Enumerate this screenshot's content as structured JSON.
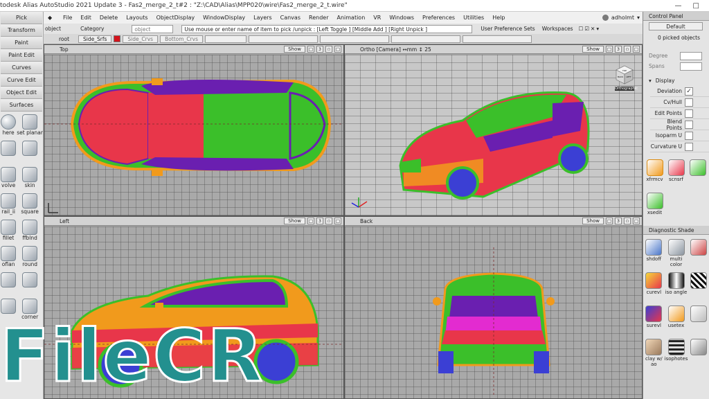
{
  "window": {
    "title": "todesk Alias AutoStudio 2021 Update 3   - Fas2_merge_2_t#2 : \"Z:\\CAD\\Alias\\MPP020\\wire\\Fas2_merge_2_t.wire\"",
    "minimize": "—",
    "maximize": "□"
  },
  "palette": {
    "buttons": [
      "Pick",
      "Transform",
      "Paint",
      "Paint Edit",
      "Curves",
      "Curve Edit",
      "Object Edit",
      "Surfaces"
    ],
    "tools": [
      {
        "label": "here",
        "icon": "sphere-icon"
      },
      {
        "label": "set planar",
        "icon": "set-planar-icon"
      },
      {
        "label": "",
        "icon": "rotate-icon"
      },
      {
        "label": "",
        "icon": "revolve-surface-icon"
      },
      {
        "label": "volve",
        "icon": "revolve-icon"
      },
      {
        "label": "skin",
        "icon": "skin-icon"
      },
      {
        "label": "rail_ii",
        "icon": "rail-icon"
      },
      {
        "label": "square",
        "icon": "square-icon"
      },
      {
        "label": "fillet",
        "icon": "fillet-icon"
      },
      {
        "label": "ffblnd",
        "icon": "ffblend-icon"
      },
      {
        "label": "oflan",
        "icon": "flange-icon"
      },
      {
        "label": "round",
        "icon": "round-icon"
      },
      {
        "label": "",
        "icon": "surface-fillet-icon"
      },
      {
        "label": "",
        "icon": "multi-blend-icon"
      },
      {
        "label": "",
        "icon": "offset-icon"
      },
      {
        "label": "corner",
        "icon": "corner-icon"
      }
    ]
  },
  "menu": {
    "items": [
      "File",
      "Edit",
      "Delete",
      "Layouts",
      "ObjectDisplay",
      "WindowDisplay",
      "Layers",
      "Canvas",
      "Render",
      "Animation",
      "VR",
      "Windows",
      "Preferences",
      "Utilities",
      "Help"
    ],
    "user": "adholmt"
  },
  "prompt": {
    "category_label": "Category",
    "object_label": "object",
    "object_type": "object",
    "message": "Use mouse or enter name of item to pick /unpick : [Left Toggle ] [Middle Add ] [Right Unpick ]",
    "user_pref": "User Preference Sets",
    "workspaces": "Workspaces"
  },
  "shelf": {
    "root_label": "root",
    "tabs": [
      "Side_Srfs",
      "Side_Crvs",
      "Bottom_Crvs"
    ]
  },
  "viewports": [
    {
      "name": "Top",
      "show": "Show",
      "num": "3"
    },
    {
      "name": "Ortho [Camera] ↔mm ↕ 25",
      "show": "Show",
      "num": "3"
    },
    {
      "name": "Left",
      "show": "Show",
      "num": "3"
    },
    {
      "name": "Back",
      "show": "Show",
      "num": "3"
    }
  ],
  "viewcube": {
    "label": "Orthographic",
    "face_top": "TOP",
    "face_front": "BACK",
    "face_side": "LEFT"
  },
  "control_panel": {
    "title": "Control Panel",
    "preset": "Default",
    "picked": "0 picked objects",
    "degree_label": "Degree",
    "spans_label": "Spans",
    "display_header": "Display",
    "display_items": [
      {
        "label": "Deviation",
        "checked": "✓"
      },
      {
        "label": "Cv/Hull",
        "checked": ""
      },
      {
        "label": "Edit Points",
        "checked": ""
      },
      {
        "label": "Blend Points",
        "checked": ""
      },
      {
        "label": "Isoparm U",
        "checked": ""
      },
      {
        "label": "Curvature U",
        "checked": ""
      }
    ],
    "tool_icons": [
      {
        "label": "xfrmcv",
        "icon": "xform-cv-icon"
      },
      {
        "label": "scnsrf",
        "icon": "scan-surface-icon"
      },
      {
        "label": "",
        "icon": "curve-tool-icon"
      },
      {
        "label": "xsedit",
        "icon": "xsection-edit-icon"
      }
    ],
    "diag_title": "Diagnostic Shade",
    "diag_items": [
      {
        "label": "shdoff",
        "icon": "shade-off-icon"
      },
      {
        "label": "multi color",
        "icon": "multi-color-icon"
      },
      {
        "label": "",
        "icon": "highlight-icon"
      },
      {
        "label": "curevl",
        "icon": "curvature-eval-icon"
      },
      {
        "label": "iso angle",
        "icon": "iso-angle-icon"
      },
      {
        "label": "",
        "icon": "zebra-icon"
      },
      {
        "label": "surevl",
        "icon": "surface-eval-icon"
      },
      {
        "label": "usetex",
        "icon": "use-texture-icon"
      },
      {
        "label": "",
        "icon": "light-icon"
      },
      {
        "label": "clay w/ ao",
        "icon": "clay-ao-icon"
      },
      {
        "label": "isophotes",
        "icon": "isophotes-icon"
      },
      {
        "label": "",
        "icon": "extra-icon"
      }
    ]
  },
  "watermark": {
    "text": "FileCR"
  },
  "colors": {
    "car_red": "#e8364a",
    "car_green": "#3bbf2a",
    "car_purple": "#6a1fb0",
    "car_orange": "#f19a1c",
    "car_magenta": "#e32bd0",
    "car_blue": "#3b3fd4",
    "watermark": "#23908f"
  }
}
